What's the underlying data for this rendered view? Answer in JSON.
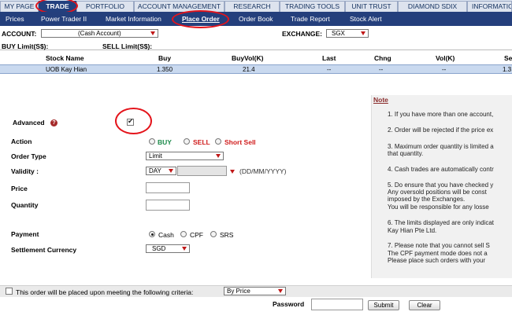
{
  "top_tabs": [
    "MY PAGE",
    "TRADE",
    "PORTFOLIO",
    "ACCOUNT MANAGEMENT",
    "RESEARCH",
    "TRADING TOOLS",
    "UNIT TRUST",
    "DIAMOND SDIX",
    "INFORMATIO"
  ],
  "sub_nav": [
    "Prices",
    "Power Trader II",
    "Market Information",
    "Place Order",
    "Order Book",
    "Trade Report",
    "Stock Alert"
  ],
  "account": {
    "label": "ACCOUNT:",
    "value": "(Cash Account)"
  },
  "exchange": {
    "label": "EXCHANGE:",
    "value": "SGX"
  },
  "limits": {
    "buy": "BUY Limit(S$):",
    "sell": "SELL Limit(S$):"
  },
  "table": {
    "headers": [
      "Stock Name",
      "Buy",
      "BuyVol(K)",
      "Last",
      "Chng",
      "Vol(K)",
      "Sell"
    ],
    "row": [
      "UOB Kay Hian",
      "1.350",
      "21.4",
      "--",
      "--",
      "--",
      "1.3"
    ]
  },
  "form": {
    "advanced": "Advanced",
    "action": "Action",
    "action_buy": "BUY",
    "action_sell": "SELL",
    "action_short": "Short Sell",
    "order_type": "Order Type",
    "order_type_value": "Limit",
    "validity": "Validity :",
    "validity_value": "DAY",
    "date_format": "(DD/MM/YYYY)",
    "price": "Price",
    "quantity": "Quantity",
    "payment": "Payment",
    "pay_cash": "Cash",
    "pay_cpf": "CPF",
    "pay_srs": "SRS",
    "settlement": "Settlement Currency",
    "settlement_value": "SGD",
    "help_icon": "?"
  },
  "note": {
    "title": "Note",
    "lines": [
      "1. If you have more than one account,",
      "2. Order will be rejected if the price ex",
      "3. Maximum order quantity is limited a",
      "    that quantity.",
      "4. Cash trades are automatically contr",
      "5. Do ensure that you have checked y",
      "    Any oversold positions will be const",
      "    imposed by the Exchanges.",
      "    You will be responsible for any losse",
      "6. The limits displayed are only indicat",
      "    Kay Hian Pte Ltd.",
      "7. Please note that you cannot sell S",
      "    The CPF payment mode does not a",
      "    Please place such orders with your"
    ]
  },
  "criteria": {
    "text": "This order will be placed upon meeting the following criteria:",
    "value": "By Price"
  },
  "password_label": "Password",
  "buttons": {
    "submit": "Submit",
    "clear": "Clear"
  }
}
